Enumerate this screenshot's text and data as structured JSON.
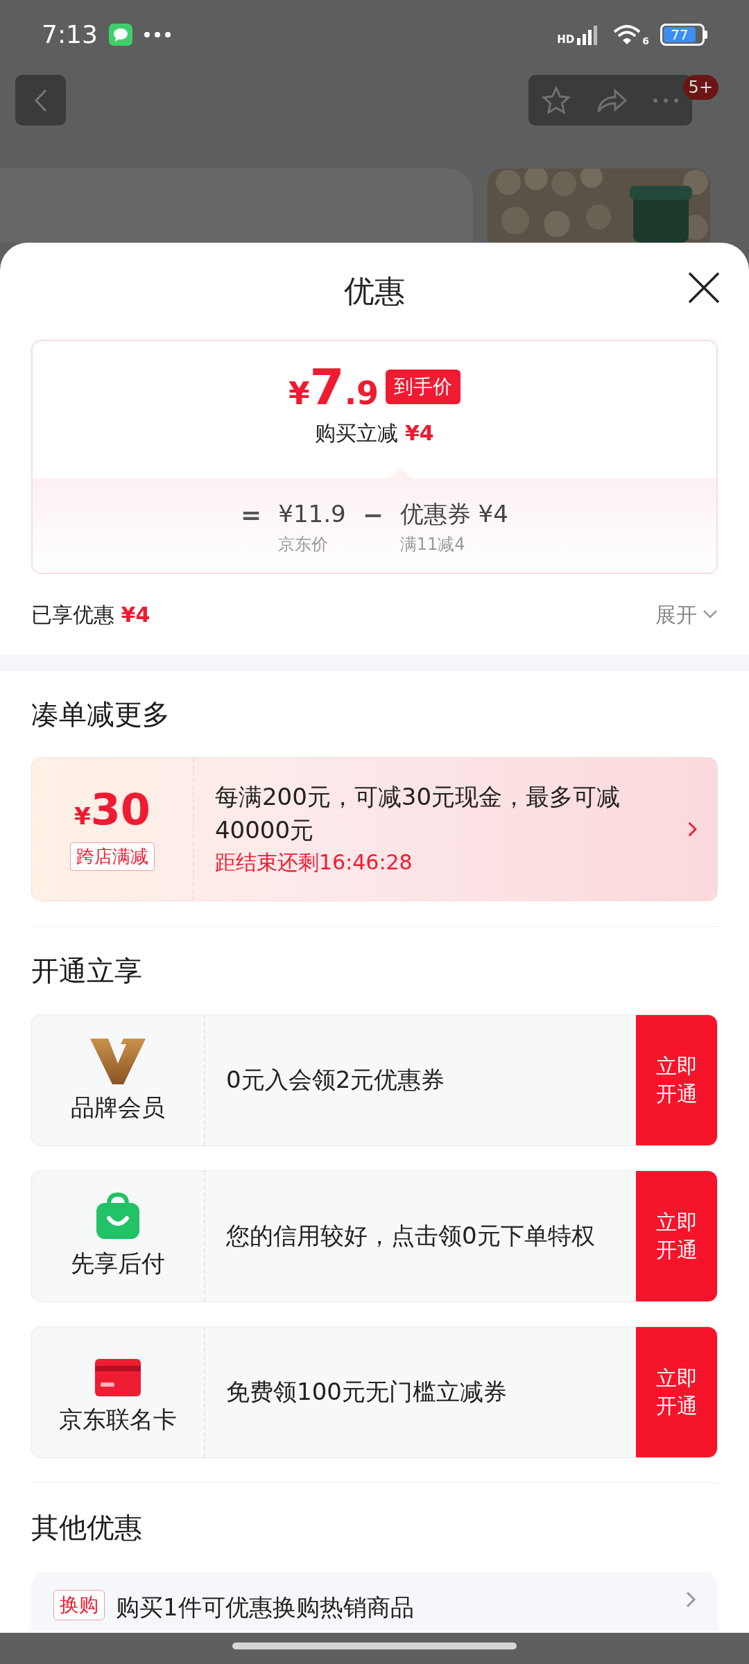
{
  "status_bar": {
    "time": "7:13",
    "network": "HD",
    "wifi_badge": "6",
    "battery": "77"
  },
  "top_nav": {
    "badge": "5+"
  },
  "sheet": {
    "title": "优惠"
  },
  "price_card": {
    "symbol": "¥",
    "price_int": "7",
    "price_dec": ".9",
    "price_tag": "到手价",
    "instant_label": "购买立减",
    "instant_amount": "¥4",
    "formula": [
      {
        "kind": "op",
        "text": "="
      },
      {
        "kind": "term",
        "text": "¥11.9",
        "sub": "京东价"
      },
      {
        "kind": "op",
        "text": "−"
      },
      {
        "kind": "term",
        "text": "优惠券 ¥4",
        "sub": "满11减4"
      }
    ]
  },
  "enjoyed": {
    "label": "已享优惠",
    "amount": "¥4",
    "expand": "展开"
  },
  "bundle": {
    "heading": "凑单减更多",
    "coupon": {
      "symbol": "¥",
      "amount": "30",
      "tag": "跨店满减",
      "description": "每满200元，可减30元现金，最多可减40000元",
      "countdown": "距结束还剩16:46:28"
    }
  },
  "activate": {
    "heading": "开通立享",
    "items": [
      {
        "kind": "brand",
        "name": "品牌会员",
        "text": "0元入会领2元优惠券",
        "button": "立即开通"
      },
      {
        "kind": "paylater",
        "name": "先享后付",
        "text": "您的信用较好，点击领0元下单特权",
        "button": "立即开通"
      },
      {
        "kind": "card",
        "name": "京东联名卡",
        "text": "免费领100元无门槛立减券",
        "button": "立即开通"
      }
    ]
  },
  "other": {
    "heading": "其他优惠",
    "items": [
      {
        "tag": "换购",
        "text": "购买1件可优惠换购热销商品"
      }
    ]
  }
}
